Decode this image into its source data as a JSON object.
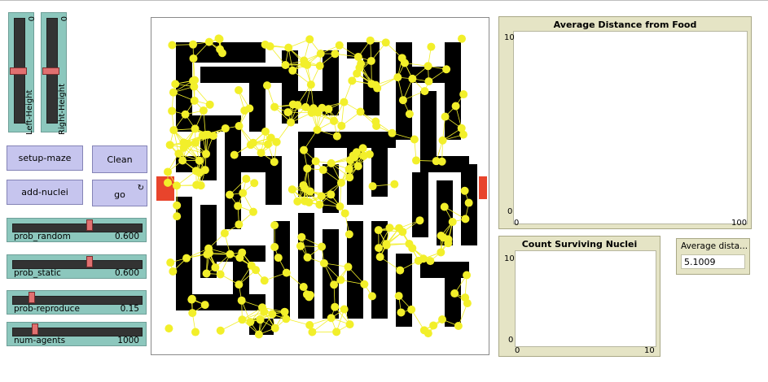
{
  "sliders_vertical": [
    {
      "label": "Left-Height",
      "value": "0",
      "position": 0.5
    },
    {
      "label": "Right-Height",
      "value": "0",
      "position": 0.5
    }
  ],
  "buttons": {
    "setup_maze": "setup-maze",
    "clean": "Clean",
    "add_nuclei": "add-nuclei",
    "go": "go",
    "forever_icon": "↻"
  },
  "sliders_horizontal": [
    {
      "label": "prob_random",
      "value": "0.600",
      "position": 0.6
    },
    {
      "label": "prob_static",
      "value": "0.600",
      "position": 0.6
    },
    {
      "label": "prob-reproduce",
      "value": "0.15",
      "position": 0.15
    },
    {
      "label": "num-agents",
      "value": "1000",
      "position": 0.18
    }
  ],
  "plots": {
    "avg_distance": {
      "title": "Average Distance from Food",
      "y_max": "10",
      "y_min": "0",
      "x_min": "0",
      "x_max": "100"
    },
    "surviving_nuclei": {
      "title": "Count Surviving Nuclei",
      "y_max": "10",
      "y_min": "0",
      "x_min": "0",
      "x_max": "10"
    }
  },
  "monitor": {
    "title": "Average dista...",
    "value": "5.1009"
  },
  "colors": {
    "slider": "#8cc7bd",
    "button": "#c6c5ee",
    "plot_bg": "#e5e4c5",
    "agent": "#f2ef2a",
    "food": "#e8442c",
    "wall": "#000000"
  }
}
